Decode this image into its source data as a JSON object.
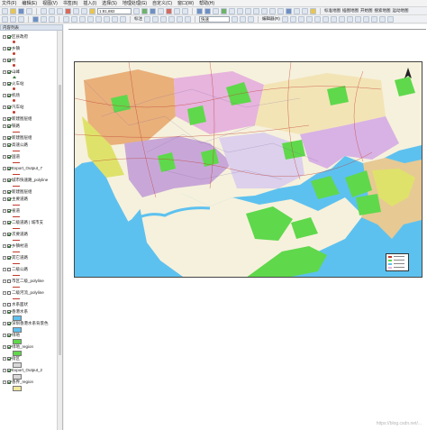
{
  "menu": [
    "文件(F)",
    "编辑(E)",
    "视图(V)",
    "书签(B)",
    "插入(I)",
    "选择(S)",
    "地理处理(G)",
    "自定义(C)",
    "窗口(W)",
    "帮助(H)"
  ],
  "toolbar": {
    "scale": "1:81,882",
    "label_dropdown": "标注",
    "speed_combo": "快速",
    "edit_label": "编辑器(R)",
    "right_menus": [
      "标准地图",
      "插图地图",
      "开始图",
      "搜索地图",
      "运动地图"
    ]
  },
  "toc": {
    "title": "内容列表"
  },
  "layers": [
    {
      "label": "区县政府",
      "checked": true,
      "expanded": true,
      "symbol": "dot"
    },
    {
      "label": "乡镇",
      "checked": true,
      "expanded": true,
      "symbol": "dot"
    },
    {
      "label": "村",
      "checked": true,
      "expanded": true,
      "symbol": "dot"
    },
    {
      "label": "山峰",
      "checked": true,
      "expanded": true,
      "symbol": "tri"
    },
    {
      "label": "火车站",
      "checked": true,
      "expanded": true,
      "symbol": "dot"
    },
    {
      "label": "机场",
      "checked": true,
      "expanded": true,
      "symbol": "dot"
    },
    {
      "label": "汽车站",
      "checked": true,
      "expanded": true,
      "symbol": "dot"
    },
    {
      "label": "新建图层组",
      "checked": true,
      "expanded": true,
      "symbol": "none"
    },
    {
      "label": "铁路",
      "checked": true,
      "expanded": true,
      "symbol": "line"
    },
    {
      "label": "新建图层组",
      "checked": true,
      "expanded": true,
      "symbol": "none"
    },
    {
      "label": "高速公路",
      "checked": true,
      "expanded": true,
      "symbol": "line"
    },
    {
      "label": "国道",
      "checked": true,
      "expanded": true,
      "symbol": "line"
    },
    {
      "label": "Export_Output_7",
      "checked": true,
      "expanded": true,
      "symbol": "line"
    },
    {
      "label": "城市快速路_polyline",
      "checked": true,
      "expanded": true,
      "symbol": "line"
    },
    {
      "label": "新建图层组",
      "checked": true,
      "expanded": true,
      "symbol": "none"
    },
    {
      "label": "主要道路",
      "checked": true,
      "expanded": true,
      "symbol": "line"
    },
    {
      "label": "省道",
      "checked": true,
      "expanded": true,
      "symbol": "line"
    },
    {
      "label": "二级道路 | 城市支",
      "checked": true,
      "expanded": true,
      "symbol": "line"
    },
    {
      "label": "次要道路",
      "checked": true,
      "expanded": true,
      "symbol": "line"
    },
    {
      "label": "乡镇村道",
      "checked": true,
      "expanded": true,
      "symbol": "line"
    },
    {
      "label": "其它道路",
      "checked": true,
      "expanded": true,
      "symbol": "line"
    },
    {
      "label": "二级公路",
      "checked": false,
      "expanded": true,
      "symbol": "line"
    },
    {
      "label": "市区二级_polyline",
      "checked": false,
      "expanded": true,
      "symbol": "line"
    },
    {
      "label": "二级河流_polyline",
      "checked": false,
      "expanded": true,
      "symbol": "line"
    },
    {
      "label": "水系面状",
      "checked": false,
      "expanded": true,
      "symbol": "none"
    },
    {
      "label": "香港水系",
      "checked": true,
      "expanded": true,
      "symbol": "fill-blue"
    },
    {
      "label": "深圳香港水系背景色",
      "checked": true,
      "expanded": true,
      "symbol": "fill-blue"
    },
    {
      "label": "绿地",
      "checked": true,
      "expanded": true,
      "symbol": "fill-green"
    },
    {
      "label": "绿地_region",
      "checked": true,
      "expanded": true,
      "symbol": "fill-green"
    },
    {
      "label": "街区",
      "checked": true,
      "expanded": true,
      "symbol": "fill-gray"
    },
    {
      "label": "Export_Output_2",
      "checked": true,
      "expanded": true,
      "symbol": "fill-gray"
    },
    {
      "label": "香界_region",
      "checked": true,
      "expanded": true,
      "symbol": "fill-yellow"
    }
  ],
  "watermark": "https://blog.csdn.net/...",
  "colors": {
    "sea": "#5dc1ef",
    "land": "#f6f1dc",
    "green": "#5fd84c",
    "pink": "#e6b4dd",
    "yellow": "#dfe26a",
    "purple": "#c8a7d8",
    "tan": "#e7c994"
  }
}
